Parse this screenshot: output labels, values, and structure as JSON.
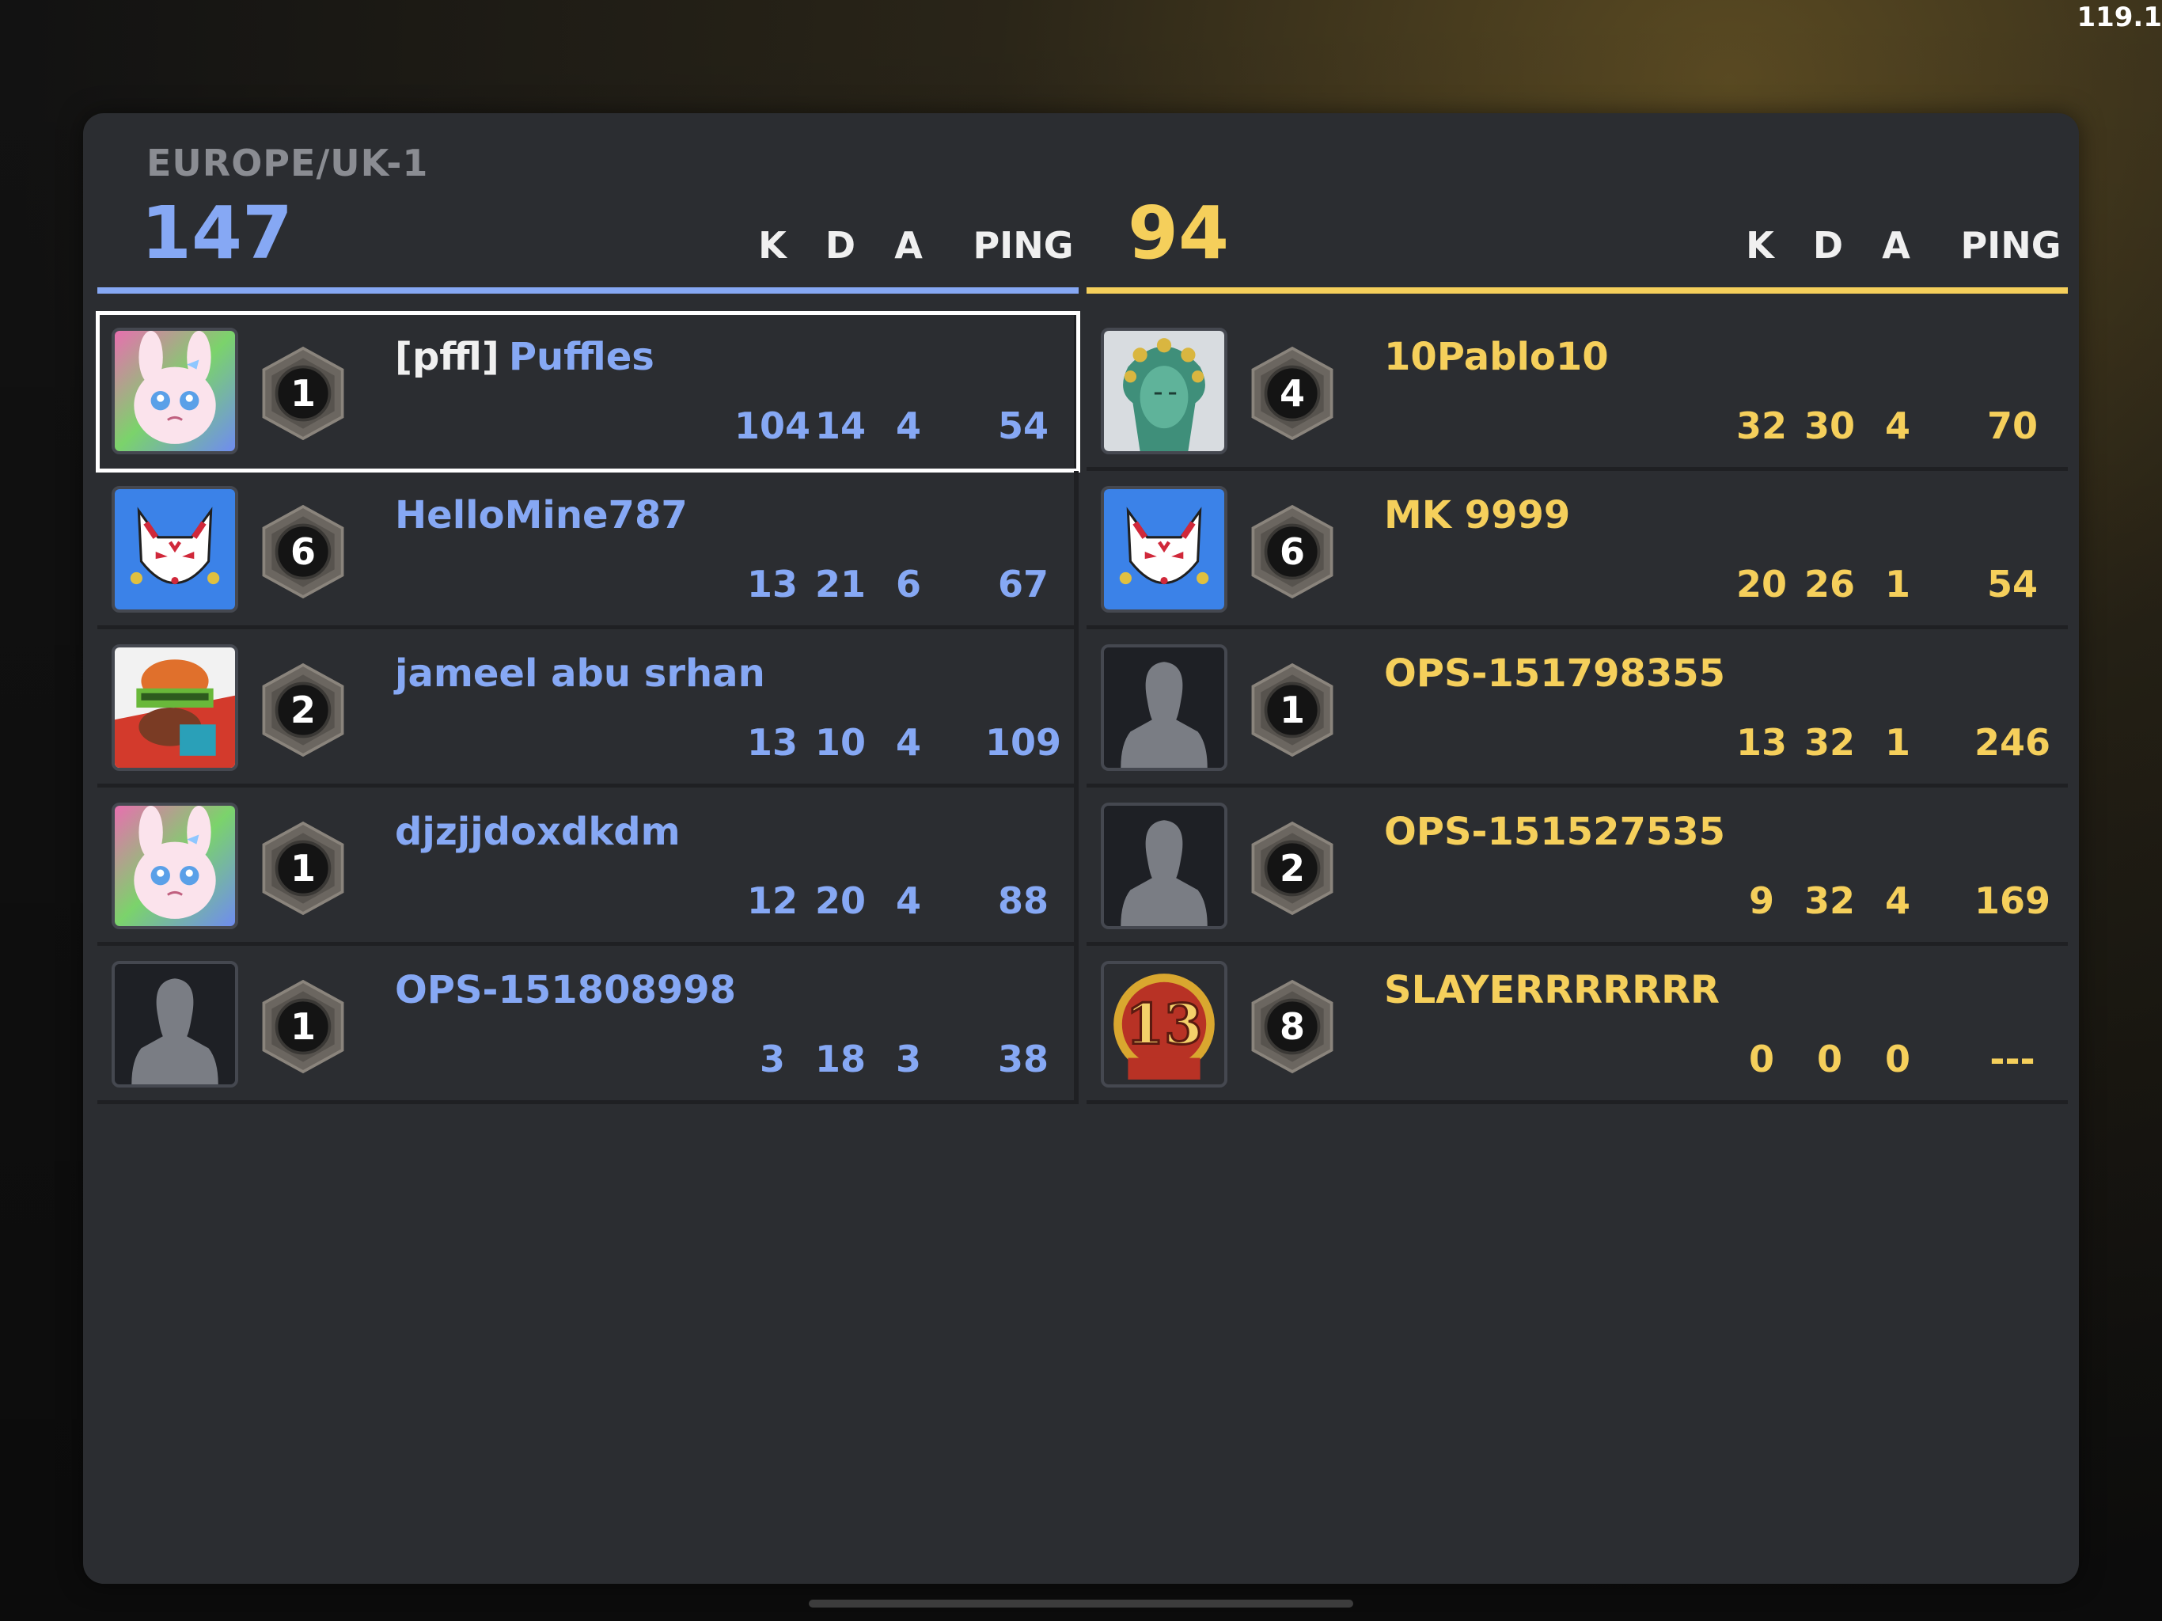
{
  "fps": "119.1",
  "server": "EUROPE/UK-1",
  "colors": {
    "blue_team": "#86a8f4",
    "yellow_team": "#f5cf5b",
    "panel": "#2b2d31"
  },
  "teams": [
    {
      "score": "147",
      "headers": {
        "k": "K",
        "d": "D",
        "a": "A",
        "ping": "PING"
      },
      "players": [
        {
          "avatar": "pink-bunny-avatar",
          "rank": "1",
          "clan": "[pffl]",
          "name": "Puffles",
          "k": "104",
          "d": "14",
          "a": "4",
          "ping": "54",
          "selected": true
        },
        {
          "avatar": "kitsune-mask-avatar",
          "rank": "6",
          "clan": "",
          "name": "HelloMine787",
          "k": "13",
          "d": "21",
          "a": "6",
          "ping": "67"
        },
        {
          "avatar": "bandana-character-avatar",
          "rank": "2",
          "clan": "",
          "name": "jameel abu srhan",
          "k": "13",
          "d": "10",
          "a": "4",
          "ping": "109"
        },
        {
          "avatar": "pink-bunny-avatar",
          "rank": "1",
          "clan": "",
          "name": "djzjjdoxdkdm",
          "k": "12",
          "d": "20",
          "a": "4",
          "ping": "88"
        },
        {
          "avatar": "default-silhouette-avatar",
          "rank": "1",
          "clan": "",
          "name": "OPS-151808998",
          "k": "3",
          "d": "18",
          "a": "3",
          "ping": "38"
        }
      ]
    },
    {
      "score": "94",
      "headers": {
        "k": "K",
        "d": "D",
        "a": "A",
        "ping": "PING"
      },
      "players": [
        {
          "avatar": "medusa-avatar",
          "rank": "4",
          "clan": "",
          "name": "10Pablo10",
          "k": "32",
          "d": "30",
          "a": "4",
          "ping": "70"
        },
        {
          "avatar": "kitsune-mask-avatar",
          "rank": "6",
          "clan": "",
          "name": "MK 9999",
          "k": "20",
          "d": "26",
          "a": "1",
          "ping": "54"
        },
        {
          "avatar": "default-silhouette-avatar",
          "rank": "1",
          "clan": "",
          "name": "OPS-151798355",
          "k": "13",
          "d": "32",
          "a": "1",
          "ping": "246"
        },
        {
          "avatar": "default-silhouette-avatar",
          "rank": "2",
          "clan": "",
          "name": "OPS-151527535",
          "k": "9",
          "d": "32",
          "a": "4",
          "ping": "169"
        },
        {
          "avatar": "number-13-badge-avatar",
          "avatar_text": "13",
          "rank": "8",
          "clan": "",
          "name": "SLAYERRRRRRR",
          "k": "0",
          "d": "0",
          "a": "0",
          "ping": "---"
        }
      ]
    }
  ]
}
